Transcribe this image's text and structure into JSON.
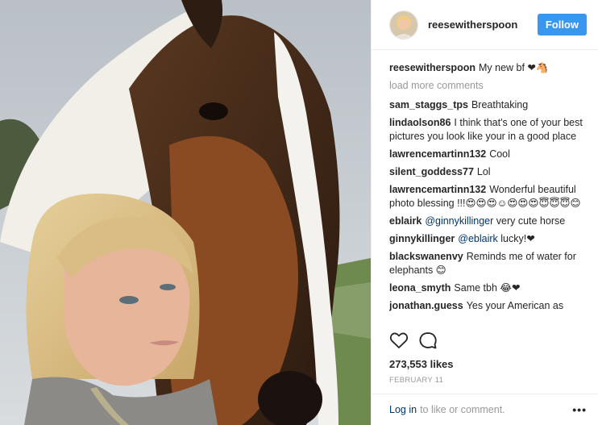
{
  "post": {
    "author": {
      "username": "reesewitherspoon",
      "follow_label": "Follow",
      "accent": "#3897f0"
    },
    "caption": {
      "username": "reesewitherspoon",
      "text": "My new bf ❤🐴"
    },
    "load_more_label": "load more comments",
    "comments": [
      {
        "user": "sam_staggs_tps",
        "text": "Breathtaking"
      },
      {
        "user": "lindaolson86",
        "text": "I think that's one of your best pictures you look like your in a good place"
      },
      {
        "user": "lawrencemartinn132",
        "text": "Cool"
      },
      {
        "user": "silent_goddess77",
        "text": "Lol"
      },
      {
        "user": "lawrencemartinn132",
        "text": "Wonderful beautiful photo blessing !!!😍😍😍☺😍😍😍😇😇😇😊"
      },
      {
        "user": "eblairk",
        "mention": "@ginnykillinger",
        "text": "very cute horse"
      },
      {
        "user": "ginnykillinger",
        "mention": "@eblairk",
        "text": "lucky!❤"
      },
      {
        "user": "blackswanenvy",
        "text": "Reminds me of water for elephants 😊"
      },
      {
        "user": "leona_smyth",
        "text": "Same tbh 😂❤"
      },
      {
        "user": "jonathan.guess",
        "text": "Yes your American as"
      }
    ],
    "icons": {
      "like": "heart-icon",
      "comment": "comment-icon",
      "more": "more-options-icon"
    },
    "likes_label": "273,553 likes",
    "date_label": "FEBRUARY 11",
    "footer": {
      "login_label": "Log in",
      "rest_text": "to like or comment.",
      "more_label": "•••"
    }
  }
}
